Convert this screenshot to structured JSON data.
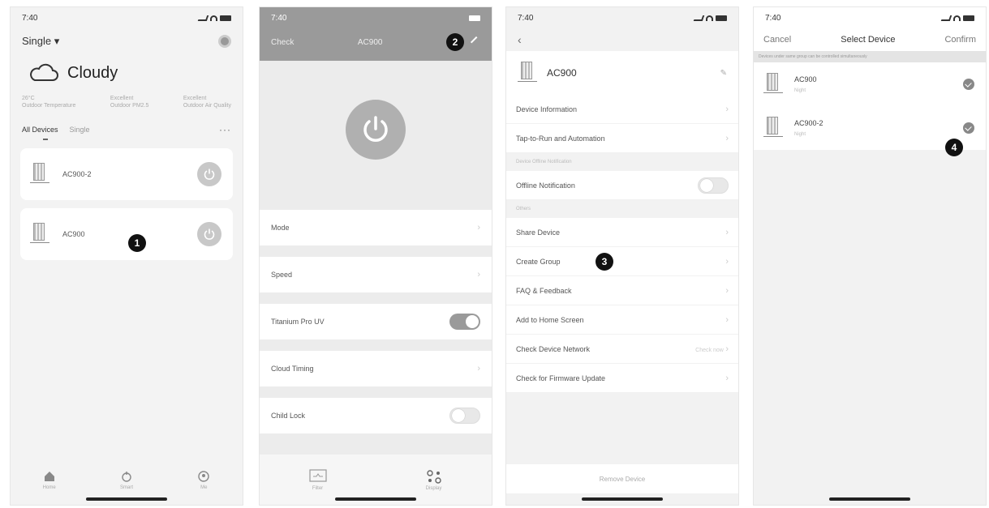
{
  "screen1": {
    "status_time": "7:40",
    "home_name": "Single",
    "weather": {
      "label": "Cloudy",
      "icon": "cloud-icon"
    },
    "weather_stats": [
      {
        "top": "26°C",
        "bottom": "Outdoor Temperature"
      },
      {
        "top": "Excellent",
        "bottom": "Outdoor PM2.5"
      },
      {
        "top": "Excellent",
        "bottom": "Outdoor Air Quality"
      }
    ],
    "tabs": {
      "all": "All Devices",
      "single": "Single",
      "more": "···"
    },
    "devices": [
      {
        "name": "AC900-2"
      },
      {
        "name": "AC900"
      }
    ],
    "marker": "1",
    "nav": [
      {
        "label": "Home",
        "icon": "home-icon"
      },
      {
        "label": "Smart",
        "icon": "smart-icon"
      },
      {
        "label": "Me",
        "icon": "me-icon"
      }
    ]
  },
  "screen2": {
    "status_time": "7:40",
    "back_label": "Check",
    "title": "AC900",
    "marker": "2",
    "controls": [
      {
        "label": "Mode",
        "kind": "chevron"
      },
      {
        "label": "Speed",
        "kind": "chevron"
      },
      {
        "label": "Titanium Pro UV",
        "kind": "toggle-on"
      },
      {
        "label": "Cloud Timing",
        "kind": "chevron"
      },
      {
        "label": "Child Lock",
        "kind": "toggle-off"
      }
    ],
    "bottom": [
      {
        "label": "Filter",
        "icon": "filter-icon"
      },
      {
        "label": "Display",
        "icon": "display-icon"
      }
    ]
  },
  "screen3": {
    "status_time": "7:40",
    "device_name": "AC900",
    "rows": [
      {
        "label": "Device Information"
      },
      {
        "label": "Tap-to-Run and Automation"
      }
    ],
    "section_offline": "Device Offline Notification",
    "offline_row": "Offline Notification",
    "section_others": "Others",
    "other_rows": [
      {
        "label": "Share Device"
      },
      {
        "label": "Create Group"
      },
      {
        "label": "FAQ & Feedback"
      },
      {
        "label": "Add to Home Screen"
      },
      {
        "label": "Check Device Network",
        "note": "Check now"
      },
      {
        "label": "Check for Firmware Update"
      }
    ],
    "marker": "3",
    "remove_label": "Remove Device"
  },
  "screen4": {
    "status_time": "7:40",
    "cancel": "Cancel",
    "title": "Select Device",
    "confirm": "Confirm",
    "notice": "Devices under same group can be controlled simultaneously",
    "devices": [
      {
        "name": "AC900",
        "sub": "Night"
      },
      {
        "name": "AC900-2",
        "sub": "Night"
      }
    ],
    "marker": "4"
  }
}
